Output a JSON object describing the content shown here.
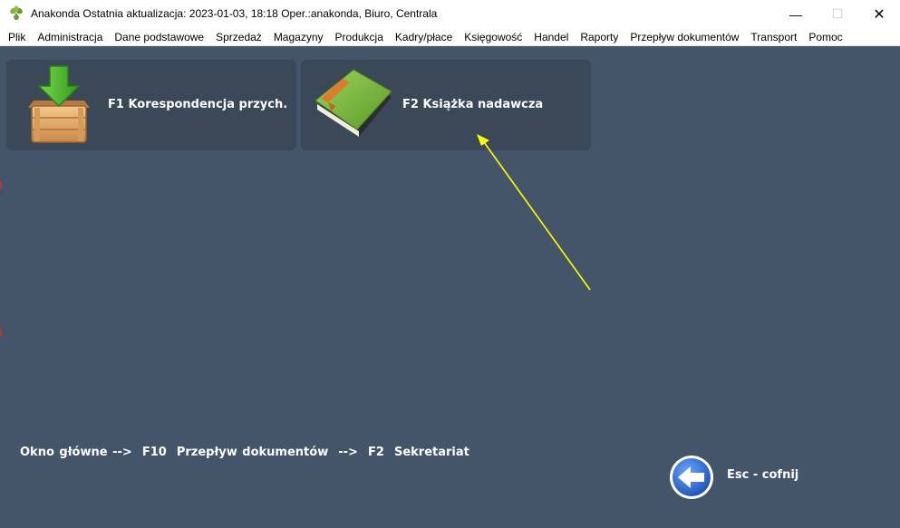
{
  "window": {
    "title": "Anakonda Ostatnia aktualizacja: 2023-01-03, 18:18 Oper.:anakonda, Biuro, Centrala",
    "minimize_glyph": "—",
    "maximize_glyph": "☐",
    "close_glyph": "✕"
  },
  "menu": {
    "items": [
      "Plik",
      "Administracja",
      "Dane podstawowe",
      "Sprzedaż",
      "Magazyny",
      "Produkcja",
      "Kadry/płace",
      "Księgowość",
      "Handel",
      "Raporty",
      "Przepływ dokumentów",
      "Transport",
      "Pomoc"
    ]
  },
  "tiles": [
    {
      "label": "F1 Korespondencja przych.",
      "icon": "incoming-box-icon"
    },
    {
      "label": "F2 Książka nadawcza",
      "icon": "green-book-icon"
    }
  ],
  "breadcrumb": "Okno główne -->  F10  Przepływ dokumentów  -->  F2  Sekretariat",
  "back": {
    "label": "Esc - cofnij",
    "icon": "back-arrow-icon"
  },
  "colors": {
    "background": "#455569",
    "tile": "#3a4858",
    "annotation_arrow": "#ffff00"
  }
}
